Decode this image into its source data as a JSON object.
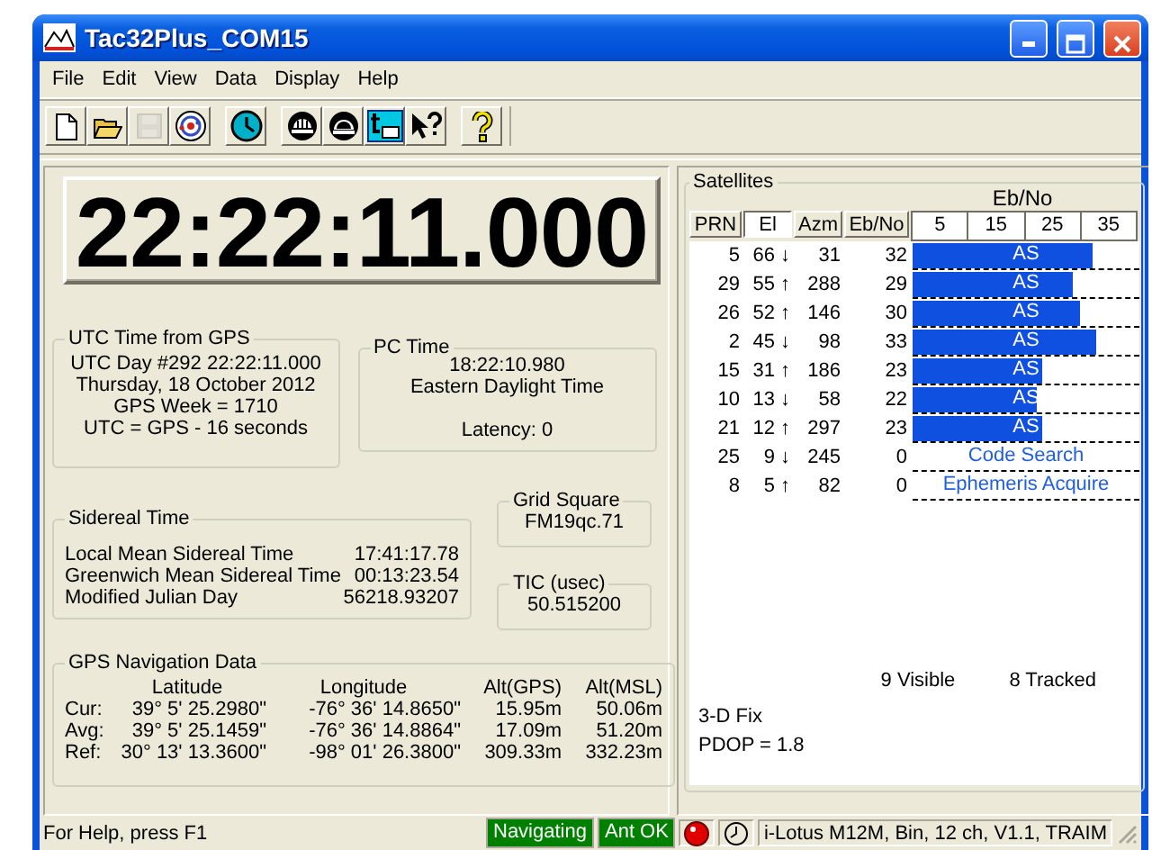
{
  "window": {
    "title": "Tac32Plus_COM15"
  },
  "menu": [
    "File",
    "Edit",
    "View",
    "Data",
    "Display",
    "Help"
  ],
  "toolbar": [
    {
      "kind": "new",
      "disabled": false
    },
    {
      "kind": "open",
      "disabled": false
    },
    {
      "kind": "save",
      "disabled": true
    },
    {
      "kind": "target",
      "disabled": false
    },
    {
      "kind": "clock",
      "disabled": false
    },
    {
      "kind": "antenna",
      "disabled": false
    },
    {
      "kind": "dome",
      "disabled": false
    },
    {
      "kind": "window",
      "disabled": false
    },
    {
      "kind": "pointer-help",
      "disabled": false
    },
    {
      "kind": "help",
      "disabled": false
    }
  ],
  "clock": "22:22:11.000",
  "utc": {
    "title": "UTC Time from GPS",
    "lines": [
      "UTC Day #292  22:22:11.000",
      "Thursday, 18 October 2012",
      "GPS Week = 1710",
      "UTC = GPS - 16 seconds"
    ]
  },
  "pc_time": {
    "title": "PC Time",
    "time": "18:22:10.980",
    "zone": "Eastern Daylight Time",
    "latency": "Latency:  0"
  },
  "sidereal": {
    "title": "Sidereal Time",
    "rows": [
      {
        "label": "Local Mean Sidereal Time",
        "value": "17:41:17.78"
      },
      {
        "label": "Greenwich Mean Sidereal Time",
        "value": "00:13:23.54"
      },
      {
        "label": "Modified Julian Day",
        "value": "56218.93207"
      }
    ]
  },
  "grid_square": {
    "title": "Grid Square",
    "value": "FM19qc.71"
  },
  "tic": {
    "title": "TIC (usec)",
    "value": "50.515200"
  },
  "navigation": {
    "title": "GPS Navigation Data",
    "columns": [
      "Latitude",
      "Longitude",
      "Alt(GPS)",
      "Alt(MSL)"
    ],
    "rows": [
      {
        "label": "Cur:",
        "latitude": "39°  5' 25.2980\"",
        "longitude": "-76° 36' 14.8650\"",
        "alt_gps": "15.95m",
        "alt_msl": "50.06m"
      },
      {
        "label": "Avg:",
        "latitude": "39°  5' 25.1459\"",
        "longitude": "-76° 36' 14.8864\"",
        "alt_gps": "17.09m",
        "alt_msl": "51.20m"
      },
      {
        "label": "Ref:",
        "latitude": "30°  13' 13.3600\"",
        "longitude": "-98° 01' 26.3800\"",
        "alt_gps": "309.33m",
        "alt_msl": "332.23m"
      }
    ]
  },
  "satellites": {
    "title": "Satellites",
    "scale_title": "Eb/No",
    "columns": [
      {
        "label": "PRN",
        "selected": false
      },
      {
        "label": "El",
        "selected": true
      },
      {
        "label": "Azm",
        "selected": false
      },
      {
        "label": "Eb/No",
        "selected": false
      }
    ],
    "scale": [
      "5",
      "15",
      "25",
      "35"
    ],
    "rows": [
      {
        "prn": "5",
        "el": "66",
        "trend": "↓",
        "azm": "31",
        "ebno": "32",
        "kind": "bar",
        "level": 0.79,
        "label": "AS"
      },
      {
        "prn": "29",
        "el": "55",
        "trend": "↑",
        "azm": "288",
        "ebno": "29",
        "kind": "bar",
        "level": 0.71,
        "label": "AS"
      },
      {
        "prn": "26",
        "el": "52",
        "trend": "↑",
        "azm": "146",
        "ebno": "30",
        "kind": "bar",
        "level": 0.74,
        "label": "AS"
      },
      {
        "prn": "2",
        "el": "45",
        "trend": "↓",
        "azm": "98",
        "ebno": "33",
        "kind": "bar",
        "level": 0.81,
        "label": "AS"
      },
      {
        "prn": "15",
        "el": "31",
        "trend": "↑",
        "azm": "186",
        "ebno": "23",
        "kind": "bar",
        "level": 0.57,
        "label": "AS"
      },
      {
        "prn": "10",
        "el": "13",
        "trend": "↓",
        "azm": "58",
        "ebno": "22",
        "kind": "bar",
        "level": 0.55,
        "label": "AS"
      },
      {
        "prn": "21",
        "el": "12",
        "trend": "↑",
        "azm": "297",
        "ebno": "23",
        "kind": "bar",
        "level": 0.57,
        "label": "AS"
      },
      {
        "prn": "25",
        "el": "9",
        "trend": "↓",
        "azm": "245",
        "ebno": "0",
        "kind": "status",
        "label": "Code Search"
      },
      {
        "prn": "8",
        "el": "5",
        "trend": "↑",
        "azm": "82",
        "ebno": "0",
        "kind": "status",
        "label": "Ephemeris Acquire"
      }
    ],
    "visible": "9 Visible",
    "tracked": "8 Tracked",
    "fix": "3-D Fix",
    "pdop": "PDOP =  1.8"
  },
  "status_bar": {
    "help": "For Help, press F1",
    "indicators": [
      "Navigating",
      "Ant OK"
    ],
    "receiver": "i-Lotus M12M, Bin, 12 ch, V1.1, TRAIM"
  }
}
